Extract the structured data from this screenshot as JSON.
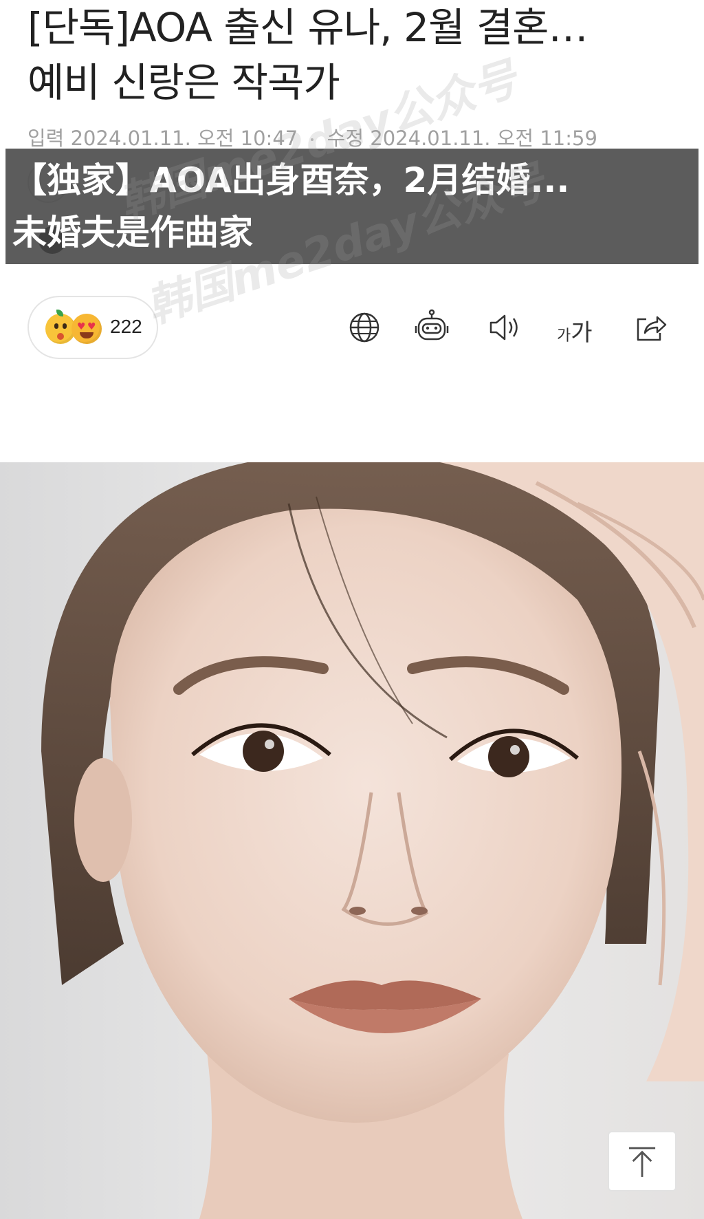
{
  "article": {
    "headline_line1": "[단독]AOA 출신 유나, 2월 결혼…",
    "headline_line2": "예비 신랑은 작곡가",
    "meta": {
      "input_label": "입력",
      "input_time": "2024.01.11. 오전 10:47",
      "modified_label": "수정",
      "modified_time": "2024.01.11. 오전 11:59"
    }
  },
  "caption_overlay": {
    "line1": "【独家】AOA出身酉奈，2月结婚...",
    "line2": "未婚夫是作曲家"
  },
  "watermark": {
    "text": "韩国me2day公众号"
  },
  "toolbar": {
    "reaction_count": "222",
    "font_size_small": "가",
    "font_size_big": "가",
    "icons": [
      "globe-icon",
      "robot-icon",
      "speaker-icon",
      "font-size-icon",
      "share-icon"
    ]
  },
  "colors": {
    "caption_bg": "#464646",
    "caption_text": "#ffffff",
    "meta_text": "#a0a0a0"
  }
}
